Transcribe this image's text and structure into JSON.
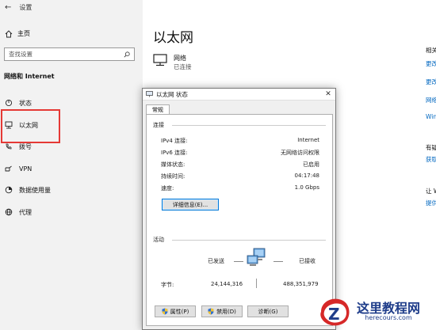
{
  "sidebar": {
    "back_icon": "back-arrow-icon",
    "window_title": "设置",
    "home_label": "主页",
    "search_placeholder": "查找设置",
    "section_title": "网络和 Internet",
    "items": [
      {
        "label": "状态",
        "icon": "status-icon"
      },
      {
        "label": "以太网",
        "icon": "ethernet-icon"
      },
      {
        "label": "拨号",
        "icon": "dialup-icon"
      },
      {
        "label": "VPN",
        "icon": "vpn-icon"
      },
      {
        "label": "数据使用量",
        "icon": "data-usage-icon"
      },
      {
        "label": "代理",
        "icon": "proxy-icon"
      }
    ],
    "highlight_color": "#e53935"
  },
  "main": {
    "title": "以太网",
    "network": {
      "name": "网络",
      "status": "已连接"
    },
    "right_col": [
      "相关",
      "更改",
      "更改",
      "网络",
      "Win",
      "有疑",
      "获取",
      "让 W",
      "提供"
    ]
  },
  "dialog": {
    "title": "以太网 状态",
    "tab": "常规",
    "connection_header": "连接",
    "rows": [
      {
        "label": "IPv4 连接:",
        "value": "Internet"
      },
      {
        "label": "IPv6 连接:",
        "value": "无网络访问权限"
      },
      {
        "label": "媒体状态:",
        "value": "已启用"
      },
      {
        "label": "持续时间:",
        "value": "04:17:48"
      },
      {
        "label": "速度:",
        "value": "1.0 Gbps"
      }
    ],
    "details_button": "详细信息(E)...",
    "activity_header": "活动",
    "sent_label": "已发送",
    "received_label": "已接收",
    "bytes_label": "字节:",
    "bytes_sent": "24,144,316",
    "bytes_received": "488,351,979",
    "buttons": {
      "properties": "属性(P)",
      "disable": "禁用(D)",
      "diagnose": "诊断(G)"
    }
  },
  "watermark": {
    "cn": "这里教程网",
    "en": "herecours.com",
    "letter": "Z"
  },
  "colors": {
    "accent": "#0067c0",
    "sidebar_bg": "#f2f2f2",
    "dialog_bg": "#f0f0f0"
  }
}
